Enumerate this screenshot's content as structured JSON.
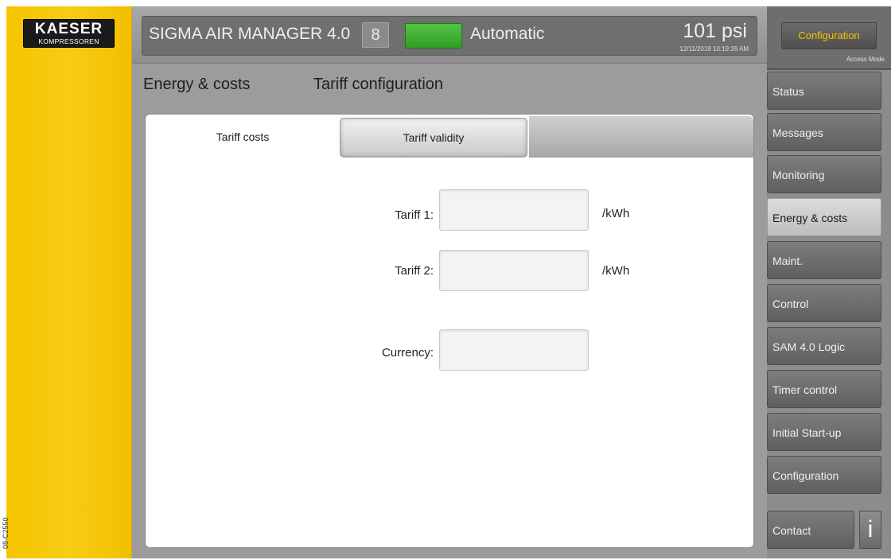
{
  "brand": {
    "line1": "KAESER",
    "line2": "KOMPRESSOREN"
  },
  "doc_code": "08-C2550",
  "header": {
    "system_title": "SIGMA AIR MANAGER 4.0",
    "system_number": "8",
    "status_color": "#3caf2e",
    "mode": "Automatic",
    "pressure": "101 psi",
    "timestamp": "12/11/2018 10:19:26 AM"
  },
  "breadcrumb": {
    "section": "Energy & costs",
    "page": "Tariff configuration"
  },
  "tabs": [
    {
      "label": "Tariff costs"
    },
    {
      "label": "Tariff validity"
    }
  ],
  "form": {
    "tariff1": {
      "label": "Tariff 1:",
      "value": "",
      "unit": "/kWh"
    },
    "tariff2": {
      "label": "Tariff 2:",
      "value": "",
      "unit": "/kWh"
    },
    "currency": {
      "label": "Currency:",
      "value": ""
    }
  },
  "nav": {
    "config_button": "Configuration",
    "access_mode": "Access Mode",
    "items": [
      {
        "label": "Status"
      },
      {
        "label": "Messages"
      },
      {
        "label": "Monitoring"
      },
      {
        "label": "Energy & costs"
      },
      {
        "label": "Maint."
      },
      {
        "label": "Control"
      },
      {
        "label": "SAM 4.0 Logic"
      },
      {
        "label": "Timer control"
      },
      {
        "label": "Initial Start-up"
      },
      {
        "label": "Configuration"
      },
      {
        "label": "Contact"
      }
    ],
    "info_label": "i"
  },
  "colors": {
    "accent_yellow": "#f5c400",
    "nav_active": "#cfcfcf"
  }
}
